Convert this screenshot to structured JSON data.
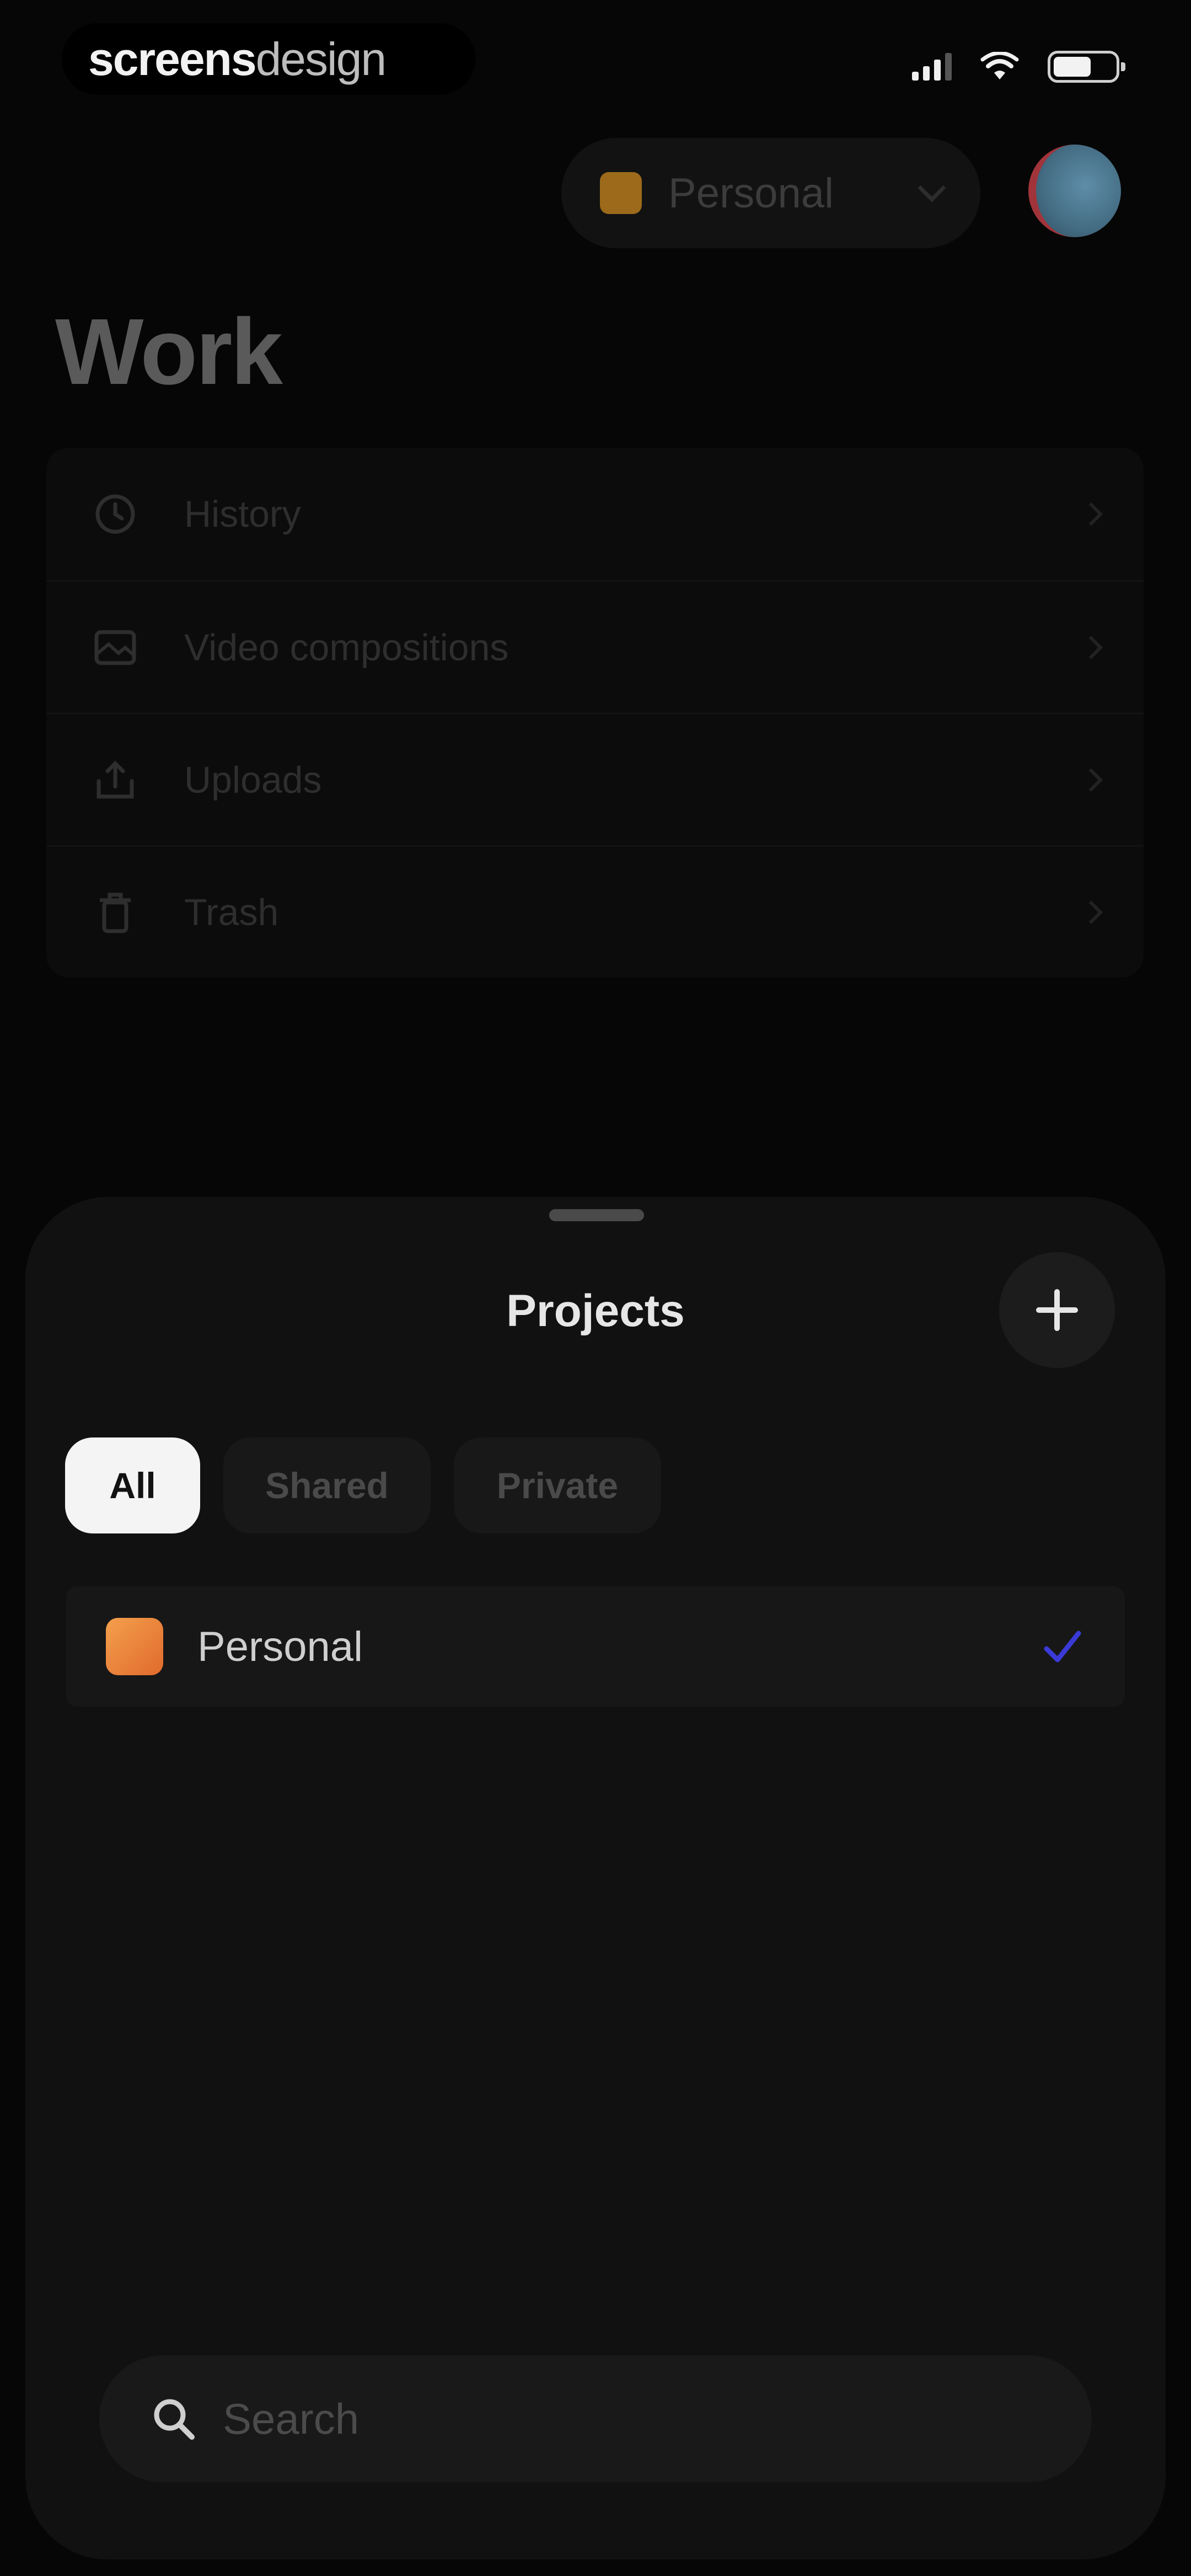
{
  "status_bar": {
    "brand_bold": "screens",
    "brand_light": "design"
  },
  "header": {
    "workspace_label": "Personal",
    "workspace_color": "#b57a1c",
    "page_title": "Work"
  },
  "menu": {
    "items": [
      {
        "label": "History",
        "icon": "history-icon"
      },
      {
        "label": "Video compositions",
        "icon": "video-composition-icon"
      },
      {
        "label": "Uploads",
        "icon": "upload-icon"
      },
      {
        "label": "Trash",
        "icon": "trash-icon"
      }
    ]
  },
  "projects_sheet": {
    "title": "Projects",
    "filters": [
      {
        "label": "All",
        "selected": true
      },
      {
        "label": "Shared",
        "selected": false
      },
      {
        "label": "Private",
        "selected": false
      }
    ],
    "projects": [
      {
        "label": "Personal",
        "color": "#f08a3c",
        "checked": true
      }
    ],
    "search_placeholder": "Search",
    "accent_color": "#3a3ad6"
  }
}
